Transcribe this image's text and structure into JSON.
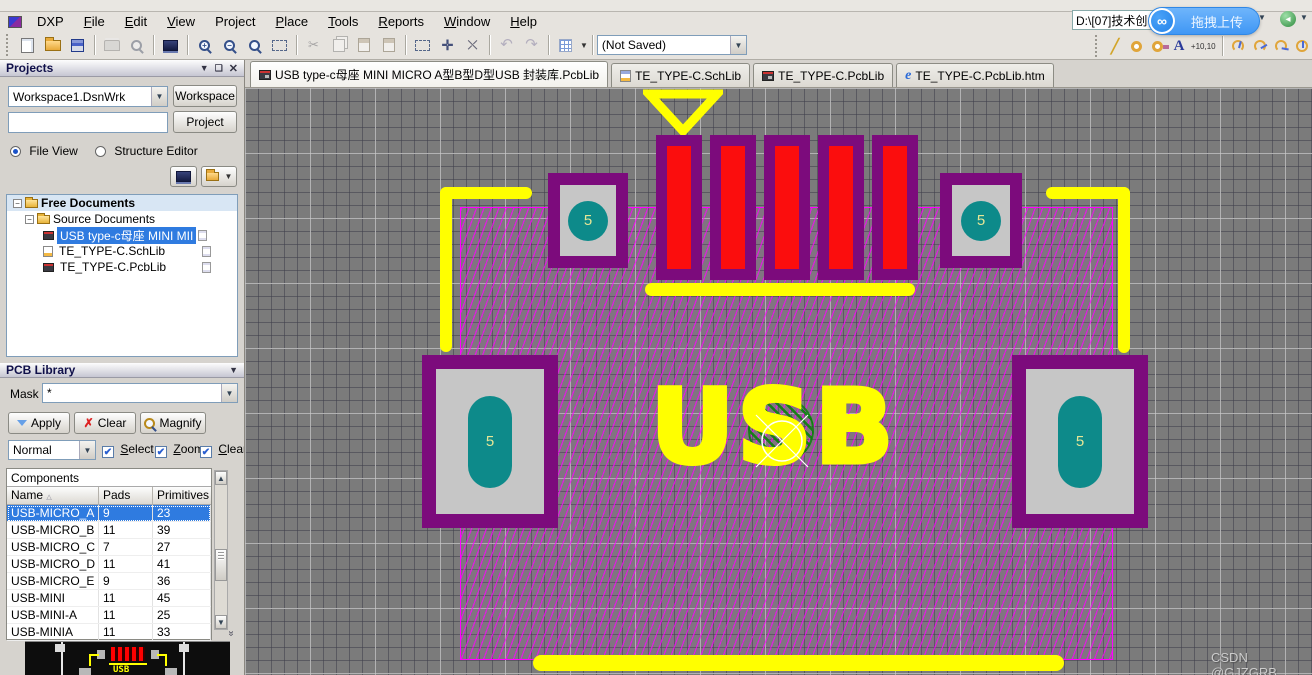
{
  "menu": {
    "items": [
      "DXP",
      "File",
      "Edit",
      "View",
      "Project",
      "Place",
      "Tools",
      "Reports",
      "Window",
      "Help"
    ]
  },
  "toolbar": {
    "not_saved": "(Not Saved)",
    "text_label": "A",
    "coord_label": "+10,10"
  },
  "upload": {
    "path": "D:\\[07]技术创",
    "button_label": "拖拽上传"
  },
  "tabs": [
    {
      "label": "USB type-c母座 MINI MICRO A型B型D型USB 封装库.PcbLib",
      "active": true
    },
    {
      "label": "TE_TYPE-C.SchLib",
      "active": false
    },
    {
      "label": "TE_TYPE-C.PcbLib",
      "active": false
    },
    {
      "label": "TE_TYPE-C.PcbLib.htm",
      "active": false
    }
  ],
  "projects": {
    "title": "Projects",
    "workspace_value": "Workspace1.DsnWrk",
    "workspace_button": "Workspace",
    "project_value": "",
    "project_button": "Project",
    "radio_file_view": "File View",
    "radio_structure": "Structure Editor",
    "tree": {
      "root": "Free Documents",
      "folder": "Source Documents",
      "items": [
        {
          "label": "USB type-c母座 MINI MII",
          "selected": true
        },
        {
          "label": "TE_TYPE-C.SchLib",
          "selected": false
        },
        {
          "label": "TE_TYPE-C.PcbLib",
          "selected": false
        }
      ]
    }
  },
  "pcb_library": {
    "title": "PCB Library",
    "mask_label": "Mask",
    "mask_value": "*",
    "apply_label": "Apply",
    "clear_label": "Clear",
    "magnify_label": "Magnify",
    "mode_value": "Normal",
    "checks": [
      "Select",
      "Zoom",
      "Clear E"
    ],
    "components_header": "Components",
    "columns": [
      "Name",
      "Pads",
      "Primitives"
    ],
    "rows": [
      {
        "name": "USB-MICRO_A",
        "pads": "9",
        "prims": "23",
        "selected": true
      },
      {
        "name": "USB-MICRO_B",
        "pads": "11",
        "prims": "39",
        "selected": false
      },
      {
        "name": "USB-MICRO_C",
        "pads": "7",
        "prims": "27",
        "selected": false
      },
      {
        "name": "USB-MICRO_D",
        "pads": "11",
        "prims": "41",
        "selected": false
      },
      {
        "name": "USB-MICRO_E",
        "pads": "9",
        "prims": "36",
        "selected": false
      },
      {
        "name": "USB-MINI",
        "pads": "11",
        "prims": "45",
        "selected": false
      },
      {
        "name": "USB-MINI-A",
        "pads": "11",
        "prims": "25",
        "selected": false
      },
      {
        "name": "USB-MINIA",
        "pads": "11",
        "prims": "33",
        "selected": false
      }
    ]
  },
  "canvas": {
    "usb_text": "USB",
    "pad_number": "5",
    "watermark": "CSDN @GJZGRB",
    "colors": {
      "background": "#7b7b7b",
      "hatch": "#ff00ff",
      "pad_red": "#fb0d0d",
      "pad_outline": "#7c0b7c",
      "hole_teal": "#0d8a8a",
      "silk_yellow": "#ffff00",
      "pad_gray": "#c6c6c6"
    }
  },
  "preview": {
    "usb_text": "USB"
  }
}
